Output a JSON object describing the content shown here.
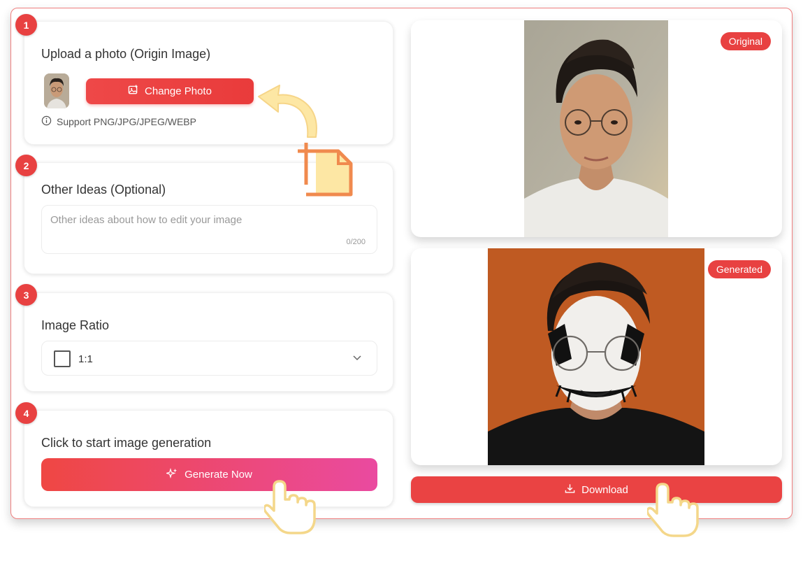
{
  "steps": {
    "upload": {
      "number": "1",
      "title": "Upload a photo (Origin Image)",
      "button_label": "Change Photo",
      "support_text": "Support PNG/JPG/JPEG/WEBP"
    },
    "ideas": {
      "number": "2",
      "title": "Other Ideas (Optional)",
      "placeholder": "Other ideas about how to edit your image",
      "counter": "0/200"
    },
    "ratio": {
      "number": "3",
      "title": "Image Ratio",
      "selected": "1:1"
    },
    "generate": {
      "number": "4",
      "title": "Click to start image generation",
      "button_label": "Generate Now"
    }
  },
  "preview": {
    "original_tag": "Original",
    "generated_tag": "Generated",
    "download_label": "Download"
  },
  "icons": {
    "change_photo": "image-plus-icon",
    "support": "info-icon",
    "ratio": "square-icon",
    "dropdown": "chevron-down-icon",
    "generate": "sparkles-icon",
    "download": "download-icon",
    "pointer": "hand-pointer-icon",
    "arrow": "curved-arrow-icon",
    "file": "file-icon"
  },
  "colors": {
    "accent": "#e84141",
    "gradient_end": "#ea4aa0"
  }
}
